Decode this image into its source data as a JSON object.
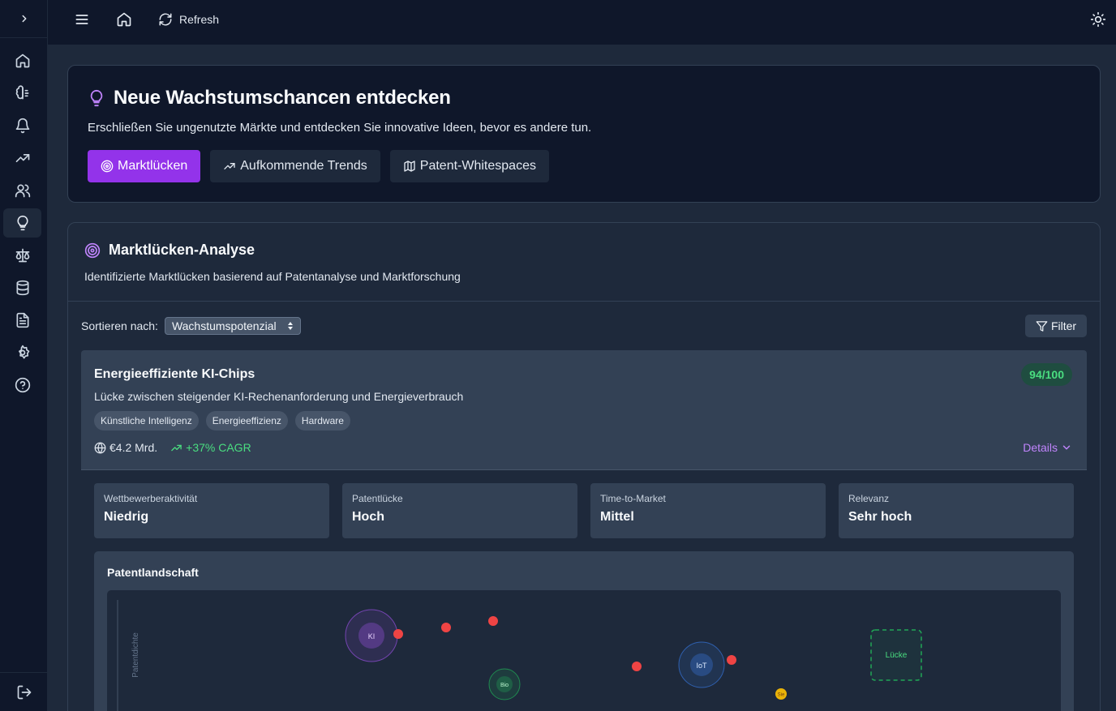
{
  "topbar": {
    "refresh_label": "Refresh"
  },
  "hero": {
    "title": "Neue Wachstumschancen entdecken",
    "subtitle": "Erschließen Sie ungenutzte Märkte und entdecken Sie innovative Ideen, bevor es andere tun.",
    "tabs": [
      {
        "label": "Marktlücken",
        "icon": "target-icon",
        "active": true
      },
      {
        "label": "Aufkommende Trends",
        "icon": "trending-up-icon",
        "active": false
      },
      {
        "label": "Patent-Whitespaces",
        "icon": "map-icon",
        "active": false
      }
    ]
  },
  "panel": {
    "title": "Marktlücken-Analyse",
    "subtitle": "Identifizierte Marktlücken basierend auf Patentanalyse und Marktforschung",
    "sort_label": "Sortieren nach:",
    "sort_value": "Wachstumspotenzial",
    "filter_label": "Filter"
  },
  "card": {
    "title": "Energieeffiziente KI-Chips",
    "score": "94/100",
    "description": "Lücke zwischen steigender KI-Rechenanforderung und Energieverbrauch",
    "tags": [
      "Künstliche Intelligenz",
      "Energieeffizienz",
      "Hardware"
    ],
    "market_size": "€4.2 Mrd.",
    "cagr": "+37% CAGR",
    "details_label": "Details"
  },
  "kpis": [
    {
      "label": "Wettbewerberaktivität",
      "value": "Niedrig"
    },
    {
      "label": "Patentlücke",
      "value": "Hoch"
    },
    {
      "label": "Time-to-Market",
      "value": "Mittel"
    },
    {
      "label": "Relevanz",
      "value": "Sehr hoch"
    }
  ],
  "landscape": {
    "title": "Patentlandschaft",
    "y_axis_label": "Patentdichte",
    "clusters": [
      {
        "label": "KI",
        "color": "#a855f7"
      },
      {
        "label": "Bio",
        "color": "#22c55e"
      },
      {
        "label": "IoT",
        "color": "#3b82f6"
      },
      {
        "label": "Sie",
        "color": "#eab308"
      }
    ],
    "gap_label": "Lücke"
  },
  "colors": {
    "accent": "#9333ea",
    "positive": "#4ade80",
    "link": "#c084fc",
    "patent_dot": "#ef4444"
  }
}
